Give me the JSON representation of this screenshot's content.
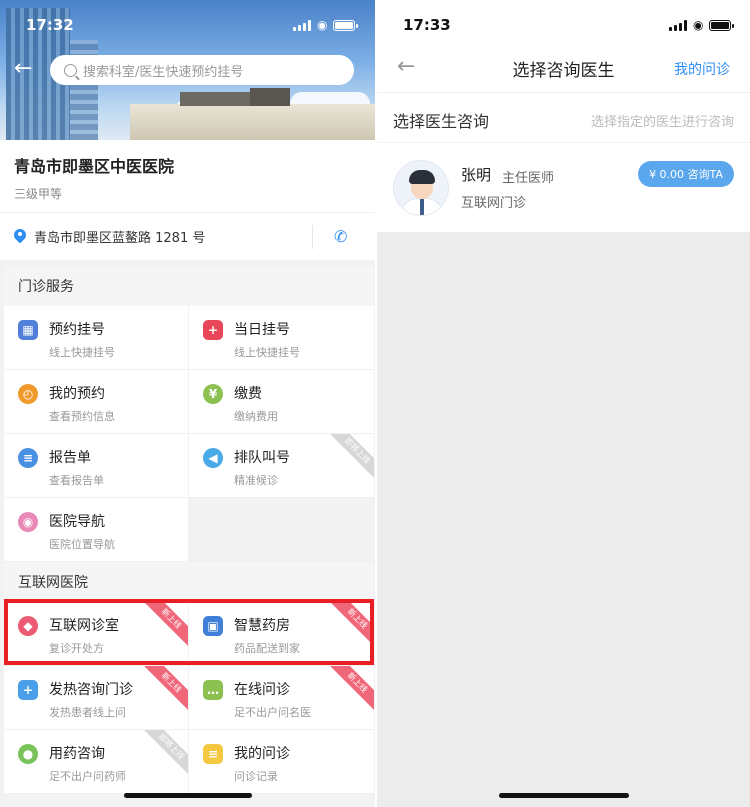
{
  "colors": {
    "accent": "#2f8ef3",
    "highlight": "#e81f25",
    "ribbon_new": "#f0677a",
    "consult_button": "#5aa7ee"
  },
  "left": {
    "status_time": "17:32",
    "search_placeholder": "搜索科室/医生快速预约挂号",
    "hospital_name": "青岛市即墨区中医医院",
    "hospital_level": "三级甲等",
    "address": "青岛市即墨区蓝鳌路 1281 号",
    "sections": [
      {
        "title": "门诊服务",
        "items": [
          {
            "title": "预约挂号",
            "sub": "线上快捷挂号",
            "icon": "calendar-icon",
            "color": "#4f7fd8"
          },
          {
            "title": "当日挂号",
            "sub": "线上快捷挂号",
            "icon": "plus-icon",
            "color": "#e8475a"
          },
          {
            "title": "我的预约",
            "sub": "查看预约信息",
            "icon": "appointment-icon",
            "color": "#f09a2b"
          },
          {
            "title": "缴费",
            "sub": "缴纳费用",
            "icon": "payment-icon",
            "color": "#8cc152"
          },
          {
            "title": "报告单",
            "sub": "查看报告单",
            "icon": "report-icon",
            "color": "#4a90e2"
          },
          {
            "title": "排队叫号",
            "sub": "精准候诊",
            "icon": "speaker-icon",
            "color": "#4aa9e8",
            "ribbon": "即将上线"
          },
          {
            "title": "医院导航",
            "sub": "医院位置导航",
            "icon": "location-icon",
            "color": "#e889b7"
          }
        ]
      },
      {
        "title": "互联网医院",
        "items": [
          {
            "title": "互联网诊室",
            "sub": "复诊开处方",
            "icon": "clinic-icon",
            "color": "#ec5b74",
            "ribbon": "新上线"
          },
          {
            "title": "智慧药房",
            "sub": "药品配送到家",
            "icon": "pharmacy-icon",
            "color": "#3f7fd8",
            "ribbon": "新上线"
          },
          {
            "title": "发热咨询门诊",
            "sub": "发热患者线上问",
            "icon": "medical-kit-icon",
            "color": "#4aa0e8",
            "ribbon": "新上线"
          },
          {
            "title": "在线问诊",
            "sub": "足不出户问名医",
            "icon": "chat-icon",
            "color": "#8cc152",
            "ribbon": "新上线"
          },
          {
            "title": "用药咨询",
            "sub": "足不出户问药师",
            "icon": "medicine-icon",
            "color": "#79c35a",
            "ribbon": "即将上线"
          },
          {
            "title": "我的问诊",
            "sub": "问诊记录",
            "icon": "consult-record-icon",
            "color": "#f5c842"
          }
        ]
      }
    ]
  },
  "right": {
    "status_time": "17:33",
    "nav_title": "选择咨询医生",
    "nav_right": "我的问诊",
    "select_title": "选择医生咨询",
    "select_hint": "选择指定的医生进行咨询",
    "doctor": {
      "name": "张明",
      "title": "主任医师",
      "dept": "互联网门诊",
      "button": "¥ 0.00 咨询TA"
    }
  }
}
